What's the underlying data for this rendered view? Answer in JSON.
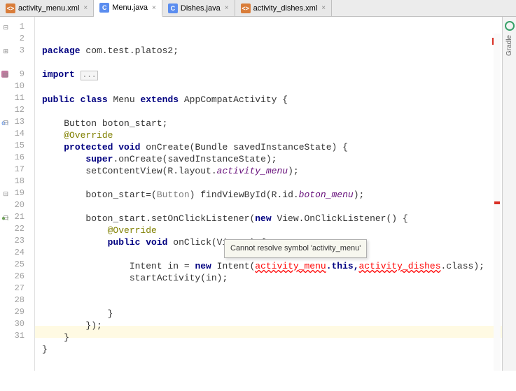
{
  "tabs": [
    {
      "label": "activity_menu.xml",
      "type": "xml",
      "active": false
    },
    {
      "label": "Menu.java",
      "type": "java",
      "active": true
    },
    {
      "label": "Dishes.java",
      "type": "java",
      "active": false
    },
    {
      "label": "activity_dishes.xml",
      "type": "xml",
      "active": false
    }
  ],
  "side": {
    "label": "Gradle"
  },
  "tooltip": {
    "text": "Cannot resolve symbol 'activity_menu'"
  },
  "lines": [
    "1",
    "2",
    "3",
    "",
    "9",
    "10",
    "11",
    "12",
    "13",
    "14",
    "15",
    "16",
    "17",
    "18",
    "19",
    "20",
    "21",
    "22",
    "23",
    "24",
    "25",
    "26",
    "27",
    "28",
    "29",
    "30",
    "31"
  ],
  "code": {
    "pkg_kw": "package",
    "pkg": " com.test.platos2;",
    "imp_kw": "import",
    "imp_fold": "...",
    "public": "public",
    "class": "class",
    "extends": "extends",
    "menu": " Menu ",
    "appcompat": " AppCompatActivity {",
    "button_decl": "    Button boton_start;",
    "override": "    @Override",
    "protected": "protected",
    "void": "void",
    "oncreate": " onCreate(Bundle savedInstanceState) {",
    "super": "super",
    "super_call": ".onCreate(savedInstanceState);",
    "setcontent": "        setContentView(R.layout.",
    "act_menu_ref": "activity_menu",
    "close_paren": ");",
    "boton_assign": "        boton_start=(",
    "button_cast": "Button",
    "findview": ") findViewById(R.id.",
    "boton_menu_ref": "boton_menu",
    "boton_listener": "        boton_start.setOnClickListener(",
    "new": "new",
    "view_listener": " View.OnClickListener() {",
    "override2": "            @Override",
    "onclick": " onClick(View v) {",
    "intent_pre": "                Intent in = ",
    "intent_new": " Intent(",
    "err_activity_menu": "activity_menu",
    "this": ".this,",
    "err_activity_dishes": "activity_dishes",
    "class_suffix": ".class);",
    "startact": "                startActivity(in);",
    "brace_close1": "            }",
    "brace_close2": "        });",
    "brace_close3": "    }",
    "brace_close4": "}"
  }
}
